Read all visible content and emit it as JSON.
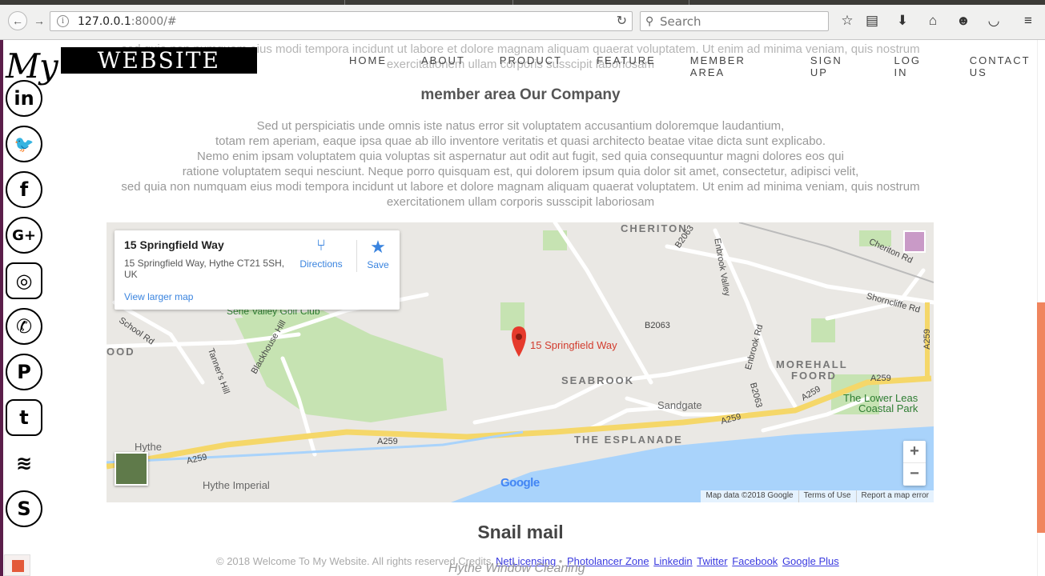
{
  "browser": {
    "url_host": "127.0.0.1",
    "url_rest": ":8000/#",
    "search_placeholder": "Search"
  },
  "site": {
    "logo_my": "My",
    "logo_word": "WEBSITE",
    "nav": [
      "HOME",
      "ABOUT",
      "PRODUCT",
      "FEATURE",
      "MEMBER AREA",
      "SIGN UP",
      "LOG IN",
      "CONTACT US"
    ],
    "ghost_line1": "sed quia non numquam eius modi tempora incidunt ut labore et dolore magnam aliquam quaerat voluptatem. Ut enim ad minima veniam, quis nostrum",
    "ghost_line2": "exercitationem ullam corporis susscipit laboriosam",
    "heading": "member area Our Company",
    "paragraph": [
      "Sed ut perspiciatis unde omnis iste natus error sit voluptatem accusantium doloremque laudantium,",
      "totam rem aperiam, eaque ipsa quae ab illo inventore veritatis et quasi architecto beatae vitae dicta sunt explicabo.",
      "Nemo enim ipsam voluptatem quia voluptas sit aspernatur aut odit aut fugit, sed quia consequuntur magni dolores eos qui",
      "ratione voluptatem sequi nesciunt. Neque porro quisquam est, qui dolorem ipsum quia dolor sit amet, consectetur, adipisci velit,",
      "sed quia non numquam eius modi tempora incidunt ut labore et dolore magnam aliquam quaerat voluptatem. Ut enim ad minima veniam, quis nostrum",
      "exercitationem ullam corporis susscipit laboriosam"
    ]
  },
  "social": [
    "linkedin-icon",
    "twitter-icon",
    "facebook-icon",
    "google-plus-icon",
    "instagram-icon",
    "whatsapp-icon",
    "pinterest-icon",
    "tumblr-icon",
    "feed-icon",
    "skype-icon"
  ],
  "social_glyphs": [
    "in",
    "🐦",
    "f",
    "G+",
    "◎",
    "✆",
    "P",
    "t",
    "≋",
    "S"
  ],
  "map": {
    "card_title": "15 Springfield Way",
    "card_address": "15 Springfield Way, Hythe CT21 5SH, UK",
    "directions": "Directions",
    "save": "Save",
    "larger": "View larger map",
    "pin_label": "15 Springfield Way",
    "labels": {
      "cheriton": "CHERITON",
      "seabrook": "SEABROOK",
      "morehall": "MOREHALL",
      "foord": "FOORD",
      "sandgate": "Sandgate",
      "esplanade": "THE ESPLANADE",
      "hythe": "Hythe",
      "hythe_imperial": "Hythe Imperial",
      "lower_leas_1": "The Lower Leas",
      "lower_leas_2": "Coastal Park",
      "golf": "Sene Valley Golf Club",
      "ood": "OOD",
      "school_rd": "School Rd",
      "tanners_hill": "Tanner's Hill",
      "blackhouse_hill": "Blackhouse Hill",
      "enbrook_valley": "Enbrook Valley",
      "enbrook_rd": "Enbrook Rd",
      "cheriton_rd": "Cheriton Rd",
      "shorncliffe_rd": "Shorncliffe Rd"
    },
    "roads": {
      "a259_a": "A259",
      "a259_b": "A259",
      "a259_c": "A259",
      "a259_d": "A259",
      "a259_e": "A259",
      "a259_f": "A259",
      "b2063_a": "B2063",
      "b2063_b": "B2063",
      "b2063_c": "B2063"
    },
    "zoom_in": "+",
    "zoom_out": "−",
    "logo": "Google",
    "attrib": [
      "Map data ©2018 Google",
      "Terms of Use",
      "Report a map error"
    ]
  },
  "snail": "Snail mail",
  "footer": {
    "text": "© 2018 Welcome To My Website. All rights reserved Credits",
    "links": [
      "NetLicensing",
      "Photolancer Zone",
      "Linkedin",
      "Twitter",
      "Facebook",
      "Google Plus"
    ],
    "bullet": "•",
    "ghost": "Hythe Window Cleaning"
  }
}
